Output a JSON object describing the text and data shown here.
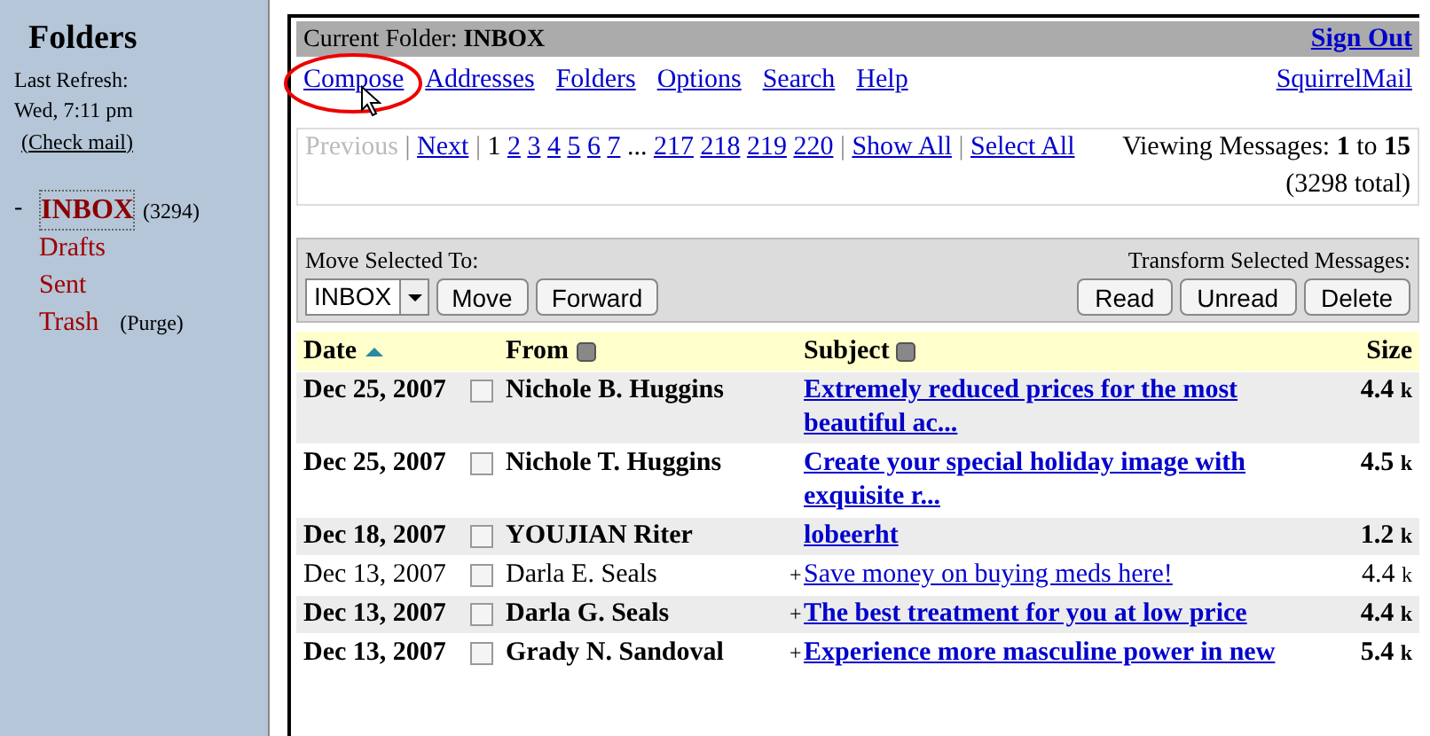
{
  "sidebar": {
    "title": "Folders",
    "refresh_label": "Last Refresh:",
    "refresh_time": "Wed, 7:11 pm",
    "check_mail": "(Check mail)",
    "collapse": "-",
    "folders": [
      {
        "name": "INBOX",
        "count": "(3294)",
        "selected": true
      },
      {
        "name": "Drafts",
        "selected": false
      },
      {
        "name": "Sent",
        "selected": false
      },
      {
        "name": "Trash",
        "action": "(Purge)",
        "selected": false
      }
    ]
  },
  "header": {
    "label": "Current Folder:",
    "folder": "INBOX",
    "sign_out": "Sign Out"
  },
  "nav": {
    "links": [
      "Compose",
      "Addresses",
      "Folders",
      "Options",
      "Search",
      "Help"
    ],
    "brand": "SquirrelMail"
  },
  "paging": {
    "previous": "Previous",
    "next": "Next",
    "current": "1",
    "pages": [
      "2",
      "3",
      "4",
      "5",
      "6",
      "7"
    ],
    "ellipsis": "...",
    "last_pages": [
      "217",
      "218",
      "219",
      "220"
    ],
    "show_all": "Show All",
    "select_all": "Select All",
    "viewing_label": "Viewing Messages:",
    "from": "1",
    "to_word": "to",
    "to": "15",
    "total": "(3298 total)"
  },
  "toolbar": {
    "move_label": "Move Selected To:",
    "folder_select": "INBOX",
    "move": "Move",
    "forward": "Forward",
    "transform_label": "Transform Selected Messages:",
    "actions": [
      "Read",
      "Unread",
      "Delete"
    ]
  },
  "table": {
    "columns": [
      "Date",
      "From",
      "Subject",
      "Size"
    ],
    "rows": [
      {
        "date": "Dec 25, 2007",
        "from": "Nichole B. Huggins",
        "subject": "Extremely reduced prices for the most beautiful ac...",
        "size": "4.4",
        "unit": "k",
        "unread": true,
        "has_attachment": false,
        "checked": false
      },
      {
        "date": "Dec 25, 2007",
        "from": "Nichole T. Huggins",
        "subject": "Create your special holiday image with exquisite r...",
        "size": "4.5",
        "unit": "k",
        "unread": true,
        "has_attachment": false,
        "checked": false
      },
      {
        "date": "Dec 18, 2007",
        "from": "YOUJIAN Riter",
        "subject": "lobeerht",
        "size": "1.2",
        "unit": "k",
        "unread": true,
        "has_attachment": false,
        "checked": false
      },
      {
        "date": "Dec 13, 2007",
        "from": "Darla E. Seals",
        "subject": "Save money on buying meds here!",
        "size": "4.4",
        "unit": "k",
        "unread": false,
        "has_attachment": true,
        "checked": false
      },
      {
        "date": "Dec 13, 2007",
        "from": "Darla G. Seals",
        "subject": "The best treatment for you at low price",
        "size": "4.4",
        "unit": "k",
        "unread": true,
        "has_attachment": true,
        "checked": false
      },
      {
        "date": "Dec 13, 2007",
        "from": "Grady N. Sandoval",
        "subject": "Experience more masculine power in new",
        "size": "5.4",
        "unit": "k",
        "unread": true,
        "has_attachment": true,
        "checked": false
      }
    ]
  },
  "attachment_mark": "+",
  "separator": "|"
}
